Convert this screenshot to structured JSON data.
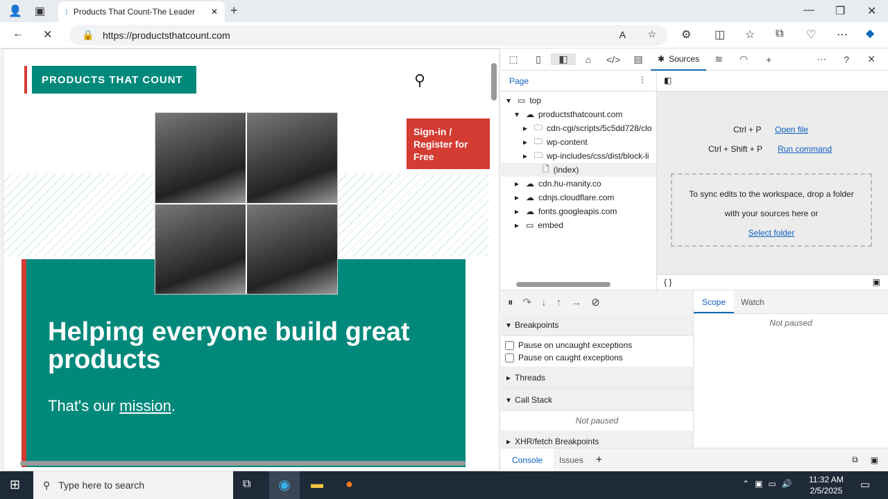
{
  "browser": {
    "tab_title": "Products That Count-The Leader",
    "url": "https://productsthatcount.com"
  },
  "page": {
    "logo": "PRODUCTS THAT COUNT",
    "signin": "Sign-in / Register for Free",
    "headline": "Helping everyone build great products",
    "mission_prefix": "That's our ",
    "mission_link": "mission",
    "mission_suffix": "."
  },
  "devtools": {
    "active_tab": "Sources",
    "nav_tab": "Page",
    "tree": [
      {
        "label": "top",
        "depth": 0,
        "icon": "frame",
        "open": true
      },
      {
        "label": "productsthatcount.com",
        "depth": 1,
        "icon": "cloud",
        "open": true
      },
      {
        "label": "cdn-cgi/scripts/5c5dd728/clo",
        "depth": 2,
        "icon": "folder"
      },
      {
        "label": "wp-content",
        "depth": 2,
        "icon": "folder"
      },
      {
        "label": "wp-includes/css/dist/block-li",
        "depth": 2,
        "icon": "folder"
      },
      {
        "label": "(index)",
        "depth": 3,
        "icon": "file"
      },
      {
        "label": "cdn.hu-manity.co",
        "depth": 1,
        "icon": "cloud"
      },
      {
        "label": "cdnjs.cloudflare.com",
        "depth": 1,
        "icon": "cloud"
      },
      {
        "label": "fonts.googleapis.com",
        "depth": 1,
        "icon": "cloud"
      },
      {
        "label": "embed",
        "depth": 1,
        "icon": "frame"
      }
    ],
    "shortcut1": "Ctrl + P",
    "open_file": "Open file",
    "shortcut2": "Ctrl + Shift + P",
    "run_command": "Run command",
    "sync_text": "To sync edits to the workspace, drop a folder with your sources here or",
    "select_folder": "Select folder",
    "breakpoints": "Breakpoints",
    "pause_uncaught": "Pause on uncaught exceptions",
    "pause_caught": "Pause on caught exceptions",
    "threads": "Threads",
    "call_stack": "Call Stack",
    "not_paused": "Not paused",
    "xhr": "XHR/fetch Breakpoints",
    "scope": "Scope",
    "watch": "Watch",
    "console": "Console",
    "issues": "Issues"
  },
  "taskbar": {
    "search_placeholder": "Type here to search",
    "time": "11:32 AM",
    "date": "2/5/2025"
  }
}
